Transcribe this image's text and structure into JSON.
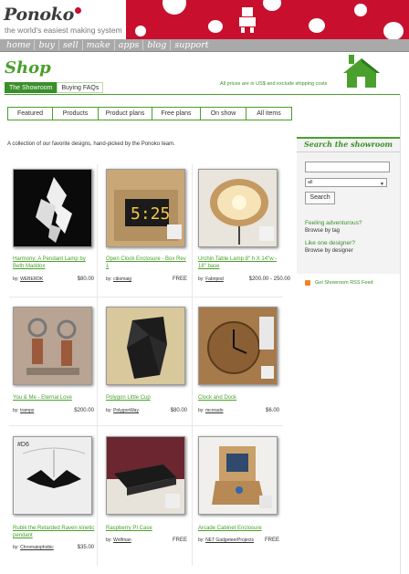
{
  "header": {
    "logo": "Ponoko",
    "tagline": "the world's easiest making system"
  },
  "nav": [
    "home",
    "buy",
    "sell",
    "make",
    "apps",
    "blog",
    "support"
  ],
  "shop": {
    "title": "Shop",
    "tabs": [
      "The Showroom",
      "Buying FAQs"
    ],
    "price_note": "All prices are in US$ and exclude shipping costs"
  },
  "subtabs": [
    "Featured",
    "Products",
    "Product plans",
    "Free plans",
    "On show",
    "All items"
  ],
  "intro": "A collection of our favorite designs, hand-picked by the Ponoko team.",
  "products": [
    {
      "title": "Harmony: A Pendant Lamp by Beth Maddox",
      "by": "by:",
      "maker": "WEBERDK",
      "price": "$80.00"
    },
    {
      "title": "Open Clock Enclosure - Box Rev 1",
      "by": "by:",
      "maker": "cibomaig",
      "price": "FREE"
    },
    {
      "title": "Urchin Table Lamp 8\" h X 14\"w - 18\" base",
      "by": "by:",
      "maker": "Fabripod",
      "price": "$200.00 - 250.00"
    },
    {
      "title": "You & Me - Eternal Love",
      "by": "by:",
      "maker": "tramps",
      "price": "$200.00"
    },
    {
      "title": "Polygon Little Cup",
      "by": "by:",
      "maker": "PolygonWay",
      "price": "$80.00"
    },
    {
      "title": "Clock and Dock",
      "by": "by:",
      "maker": "mcnrado",
      "price": "$6.00"
    },
    {
      "title": "Rubik the Retarded Raven kinetic pendant",
      "by": "by:",
      "maker": "Chromatophobic",
      "price": "$35.00"
    },
    {
      "title": "Raspberry PI Case",
      "by": "by:",
      "maker": "Wolfman",
      "price": "FREE"
    },
    {
      "title": "Arcade Cabinet Enclosure",
      "by": "by:",
      "maker": "NET GadgeteerProjects",
      "price": "FREE"
    }
  ],
  "sidebar": {
    "title": "Search the showroom",
    "select_value": "all",
    "search_button": "Search",
    "feeling_link": "Feeling adventurous?",
    "feeling_sub": "Browse by tag",
    "designer_link": "Like one designer?",
    "designer_sub": "Browse by designer"
  },
  "rss": "Get Showroom RSS Feed"
}
